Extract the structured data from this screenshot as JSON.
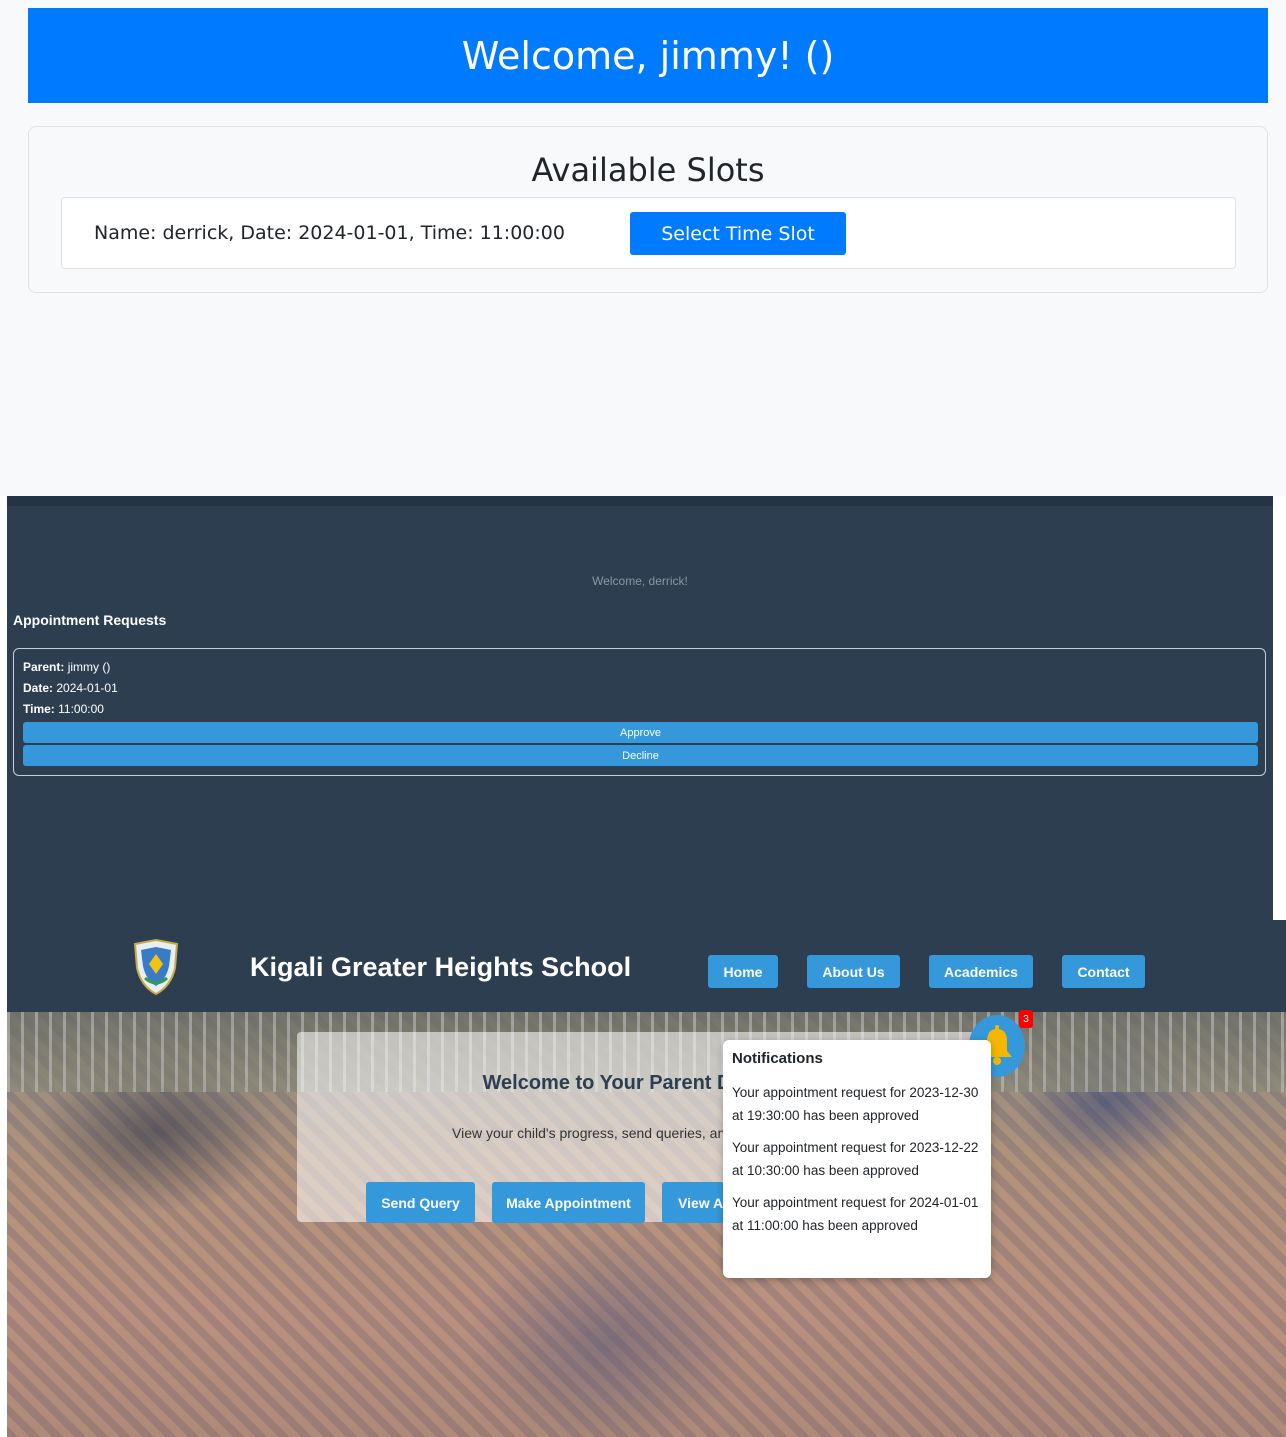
{
  "parent_slots": {
    "welcome": "Welcome, jimmy! ()",
    "title": "Available Slots",
    "slots": [
      {
        "text": "Name: derrick, Date: 2024-01-01, Time: 11:00:00",
        "button_label": "Select Time Slot"
      }
    ],
    "colors": {
      "primary": "#007bff"
    }
  },
  "teacher_dashboard": {
    "welcome": "Welcome, derrick!",
    "heading": "Appointment Requests",
    "request": {
      "parent_label": "Parent:",
      "parent_value": "jimmy ()",
      "date_label": "Date:",
      "date_value": "2024-01-01",
      "time_label": "Time:",
      "time_value": "11:00:00",
      "approve_label": "Approve",
      "decline_label": "Decline"
    },
    "colors": {
      "background": "#2d3e50",
      "button": "#3498db"
    }
  },
  "parent_dashboard": {
    "school_name": "Kigali Greater Heights School",
    "logo_icon": "school-crest-icon",
    "nav": [
      "Home",
      "About Us",
      "Academics",
      "Contact"
    ],
    "welcome_title": "Welcome to Your Parent D",
    "welcome_sub": "View your child's progress, send queries, and",
    "actions": [
      "Send Query",
      "Make Appointment",
      "View A"
    ],
    "bell_icon": "bell-icon",
    "notification_count": "3",
    "notifications": {
      "title": "Notifications",
      "items": [
        "Your appointment request for 2023-12-30 at 19:30:00 has been approved",
        "Your appointment request for 2023-12-22 at 10:30:00 has been approved",
        "Your appointment request for 2024-01-01 at 11:00:00 has been approved"
      ]
    },
    "colors": {
      "header": "#2d3e50",
      "accent": "#3498db",
      "badge": "#ff0000"
    }
  }
}
